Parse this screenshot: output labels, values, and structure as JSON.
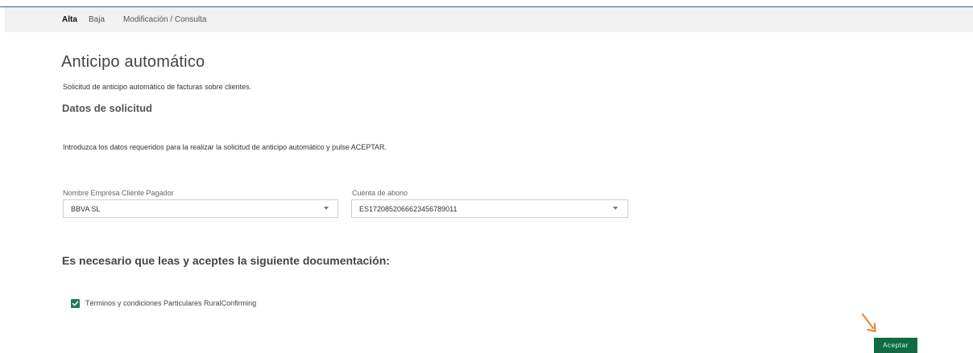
{
  "tabs": {
    "alta": "Alta",
    "baja": "Baja",
    "modificacion": "Modificación / Consulta"
  },
  "page": {
    "title": "Anticipo automático",
    "description": "Solicitud de anticipo automático de facturas sobre clientes.",
    "subtitle": "Datos de solicitud",
    "instructions": "Introduzca los datos requeridos para la realizar la solicitud de anticipo automático y pulse ACEPTAR."
  },
  "form": {
    "company_label": "Nombre Empresa Cliente Pagador",
    "company_value": "BBVA SL",
    "account_label": "Cuenta de abono",
    "account_value": "ES1720852066623456789011"
  },
  "documentation": {
    "heading": "Es necesario que leas y aceptes la siguiente documentación:",
    "terms_label": "Términos y condiciones Particulares RuralConfirming",
    "terms_checked": true
  },
  "actions": {
    "accept_label": "Aceptar"
  },
  "colors": {
    "accent": "#0e6b44",
    "checkbox": "#1e7a63",
    "arrow": "#e8873a"
  },
  "icons": {
    "dropdown": "chevron-down-icon",
    "check": "check-icon",
    "pointer": "arrow-icon"
  }
}
